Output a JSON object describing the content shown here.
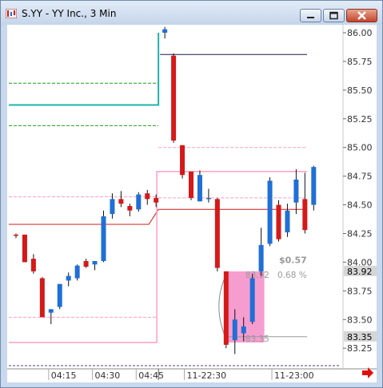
{
  "window": {
    "title": "S.YY - YY Inc., 3 Min",
    "icons": {
      "app": "chart-app-icon",
      "minimize": "minimize-icon",
      "maximize": "maximize-icon",
      "close": "close-icon",
      "scroll": "scroll-right-arrow-icon"
    }
  },
  "colors": {
    "up": "#1f6fd6",
    "down": "#d41919",
    "teal_line": "#20b2aa",
    "green_dash": "#1aa31a",
    "pink": "#ff9ec4",
    "highlight": "#f58cc8",
    "dark_line": "#1a1a4d",
    "red_line": "#d41919"
  },
  "chart_data": {
    "type": "candlestick",
    "y_ticks": [
      "86.00",
      "85.75",
      "85.50",
      "85.25",
      "85.00",
      "84.75",
      "84.50",
      "84.25",
      "84.00",
      "83.75",
      "83.50",
      "83.25"
    ],
    "x_ticks": [
      "04:15",
      "04:30",
      "04:45",
      "11-22:30",
      "11-23:00"
    ],
    "ylim": [
      83.15,
      86.05
    ],
    "price_labels": [
      "83.92",
      "83.35"
    ],
    "annotation": {
      "change": "$0.57",
      "pct": "0.68 %",
      "high": "83.92",
      "low": "83.35"
    },
    "candles": [
      {
        "o": 84.24,
        "h": 84.25,
        "l": 84.21,
        "c": 84.23
      },
      {
        "o": 84.24,
        "h": 84.24,
        "l": 84.0,
        "c": 84.0
      },
      {
        "o": 84.03,
        "h": 84.07,
        "l": 83.9,
        "c": 83.92
      },
      {
        "o": 83.86,
        "h": 83.87,
        "l": 83.52,
        "c": 83.52
      },
      {
        "o": 83.56,
        "h": 83.59,
        "l": 83.46,
        "c": 83.59
      },
      {
        "o": 83.61,
        "h": 83.81,
        "l": 83.59,
        "c": 83.81
      },
      {
        "o": 83.84,
        "h": 83.91,
        "l": 83.79,
        "c": 83.88
      },
      {
        "o": 83.86,
        "h": 83.98,
        "l": 83.84,
        "c": 83.97
      },
      {
        "o": 84.01,
        "h": 84.03,
        "l": 83.95,
        "c": 83.96
      },
      {
        "o": 83.98,
        "h": 84.01,
        "l": 83.93,
        "c": 84.01
      },
      {
        "o": 84.01,
        "h": 84.45,
        "l": 84.0,
        "c": 84.4
      },
      {
        "o": 84.42,
        "h": 84.6,
        "l": 84.38,
        "c": 84.55
      },
      {
        "o": 84.55,
        "h": 84.62,
        "l": 84.48,
        "c": 84.51
      },
      {
        "o": 84.49,
        "h": 84.51,
        "l": 84.4,
        "c": 84.45
      },
      {
        "o": 84.46,
        "h": 84.61,
        "l": 84.44,
        "c": 84.59
      },
      {
        "o": 84.6,
        "h": 84.63,
        "l": 84.5,
        "c": 84.55
      },
      {
        "o": 84.56,
        "h": 84.59,
        "l": 84.48,
        "c": 84.52
      },
      {
        "o": 86.0,
        "h": 86.05,
        "l": 85.95,
        "c": 86.03
      },
      {
        "o": 85.8,
        "h": 85.82,
        "l": 85.04,
        "c": 85.06
      },
      {
        "o": 85.02,
        "h": 85.02,
        "l": 84.73,
        "c": 84.76
      },
      {
        "o": 84.79,
        "h": 84.79,
        "l": 84.54,
        "c": 84.56
      },
      {
        "o": 84.53,
        "h": 84.8,
        "l": 84.53,
        "c": 84.76
      },
      {
        "o": 84.56,
        "h": 84.64,
        "l": 84.52,
        "c": 84.56
      },
      {
        "o": 84.55,
        "h": 84.56,
        "l": 83.92,
        "c": 83.95
      },
      {
        "o": 83.92,
        "h": 83.92,
        "l": 83.25,
        "c": 83.28
      },
      {
        "o": 83.32,
        "h": 83.59,
        "l": 83.2,
        "c": 83.5
      },
      {
        "o": 83.38,
        "h": 83.52,
        "l": 83.31,
        "c": 83.44
      },
      {
        "o": 83.48,
        "h": 83.9,
        "l": 83.46,
        "c": 83.86
      },
      {
        "o": 83.92,
        "h": 84.3,
        "l": 83.88,
        "c": 84.15
      },
      {
        "o": 84.16,
        "h": 84.74,
        "l": 84.14,
        "c": 84.71
      },
      {
        "o": 84.5,
        "h": 84.54,
        "l": 84.18,
        "c": 84.2
      },
      {
        "o": 84.26,
        "h": 84.51,
        "l": 84.22,
        "c": 84.45
      },
      {
        "o": 84.52,
        "h": 84.81,
        "l": 84.42,
        "c": 84.72
      },
      {
        "o": 84.55,
        "h": 84.78,
        "l": 84.25,
        "c": 84.28
      },
      {
        "o": 84.5,
        "h": 84.84,
        "l": 84.45,
        "c": 84.83
      }
    ]
  }
}
